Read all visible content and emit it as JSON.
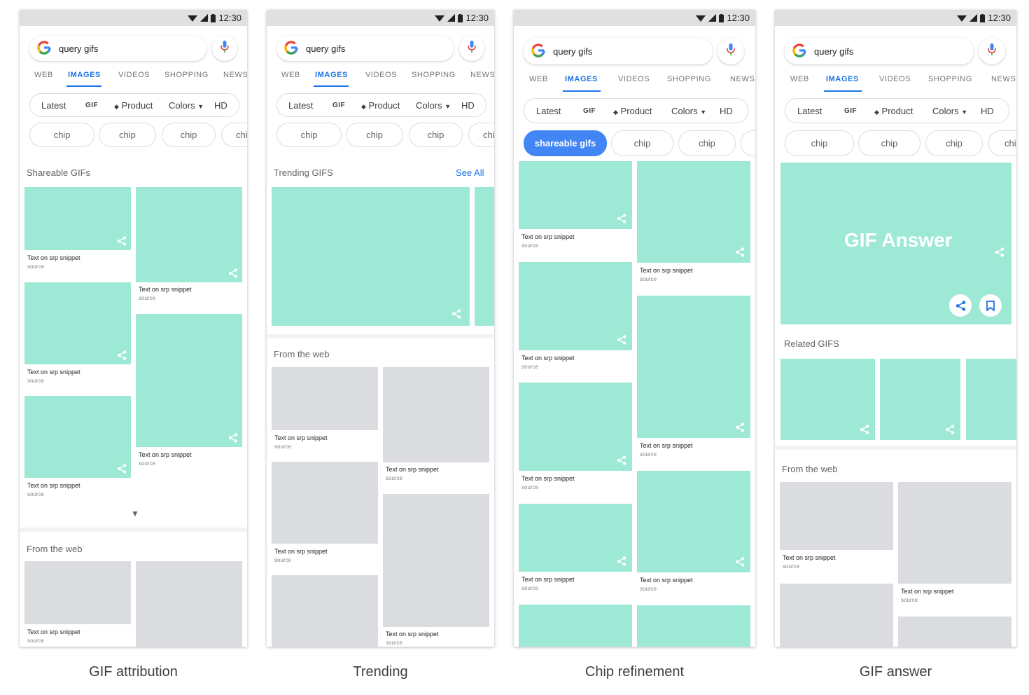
{
  "status": {
    "time": "12:30"
  },
  "search": {
    "query": "query gifs"
  },
  "tabs": [
    "WEB",
    "IMAGES",
    "VIDEOS",
    "SHOPPING",
    "NEWS"
  ],
  "filters": {
    "latest": "Latest",
    "gif": "GIF",
    "product": "Product",
    "colors": "Colors",
    "hd": "HD"
  },
  "chip": {
    "label": "chip",
    "partial": "chi",
    "selected": "shareable gifs"
  },
  "snippet": {
    "text": "Text on srp snippet",
    "source": "source"
  },
  "sections": {
    "shareable": "Shareable GIFs",
    "trending": "Trending GIFS",
    "see_all": "See All",
    "from_web": "From the web",
    "related": "Related GIFS"
  },
  "gif_answer": {
    "label": "GIF Answer"
  },
  "captions": [
    "GIF attribution",
    "Trending",
    "Chip refinement",
    "GIF answer"
  ],
  "colors": {
    "gif_tile": "#9ee9d5",
    "web_tile": "#dadce0",
    "accent": "#1a73e8"
  },
  "icons": [
    "google-g-logo",
    "mic-icon",
    "wifi-icon",
    "signal-icon",
    "battery-icon",
    "tag-icon",
    "dropdown-arrow-icon",
    "share-icon",
    "bookmark-icon",
    "expand-arrow-icon"
  ]
}
